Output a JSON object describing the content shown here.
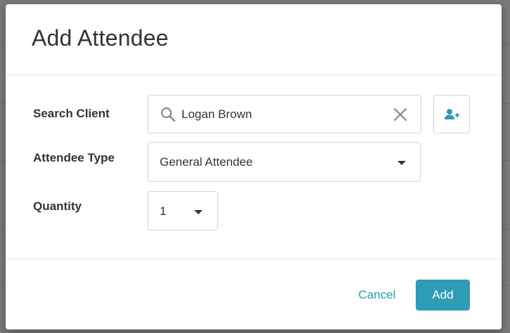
{
  "dialog": {
    "title": "Add Attendee"
  },
  "form": {
    "search_client": {
      "label": "Search Client",
      "value": "Logan Brown",
      "icon": "search-icon",
      "clear_icon": "close-icon"
    },
    "add_client": {
      "icon": "add-user-icon"
    },
    "attendee_type": {
      "label": "Attendee Type",
      "selected": "General Attendee"
    },
    "quantity": {
      "label": "Quantity",
      "selected": "1"
    }
  },
  "footer": {
    "cancel_label": "Cancel",
    "add_label": "Add"
  },
  "colors": {
    "accent": "#2d9cb4",
    "link": "#2a9bb3",
    "backdrop": "#7a7a7a",
    "text": "#333333"
  }
}
